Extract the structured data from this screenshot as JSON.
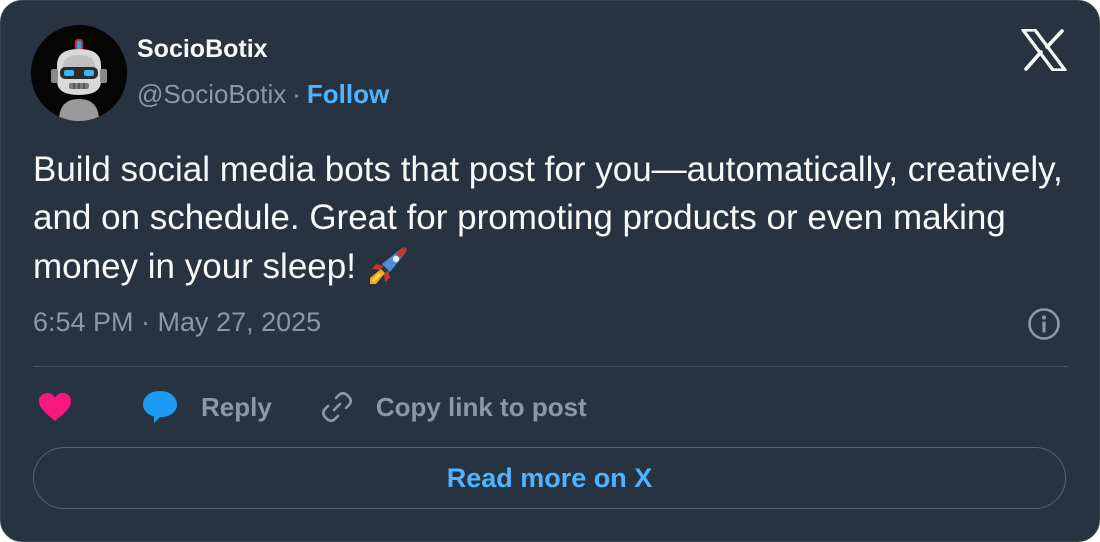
{
  "author": {
    "display_name": "SocioBotix",
    "handle": "@SocioBotix",
    "separator": "·",
    "follow_label": "Follow",
    "avatar_icon": "robot-avatar"
  },
  "tweet": {
    "text": "Build social media bots that post for you—automatically, creatively, and on schedule. Great for promoting products or even making money in your sleep!",
    "emoji_icon": "rocket-icon",
    "timestamp": "6:54 PM · May 27, 2025"
  },
  "actions": {
    "like_icon": "heart-icon",
    "reply_label": "Reply",
    "copy_link_label": "Copy link to post"
  },
  "footer": {
    "read_more_label": "Read more on X"
  },
  "colors": {
    "background": "#273340",
    "text": "#f7f9f9",
    "muted": "#8b98a5",
    "link": "#4fb3ff",
    "like": "#f91880",
    "reply": "#1d9bf0"
  }
}
